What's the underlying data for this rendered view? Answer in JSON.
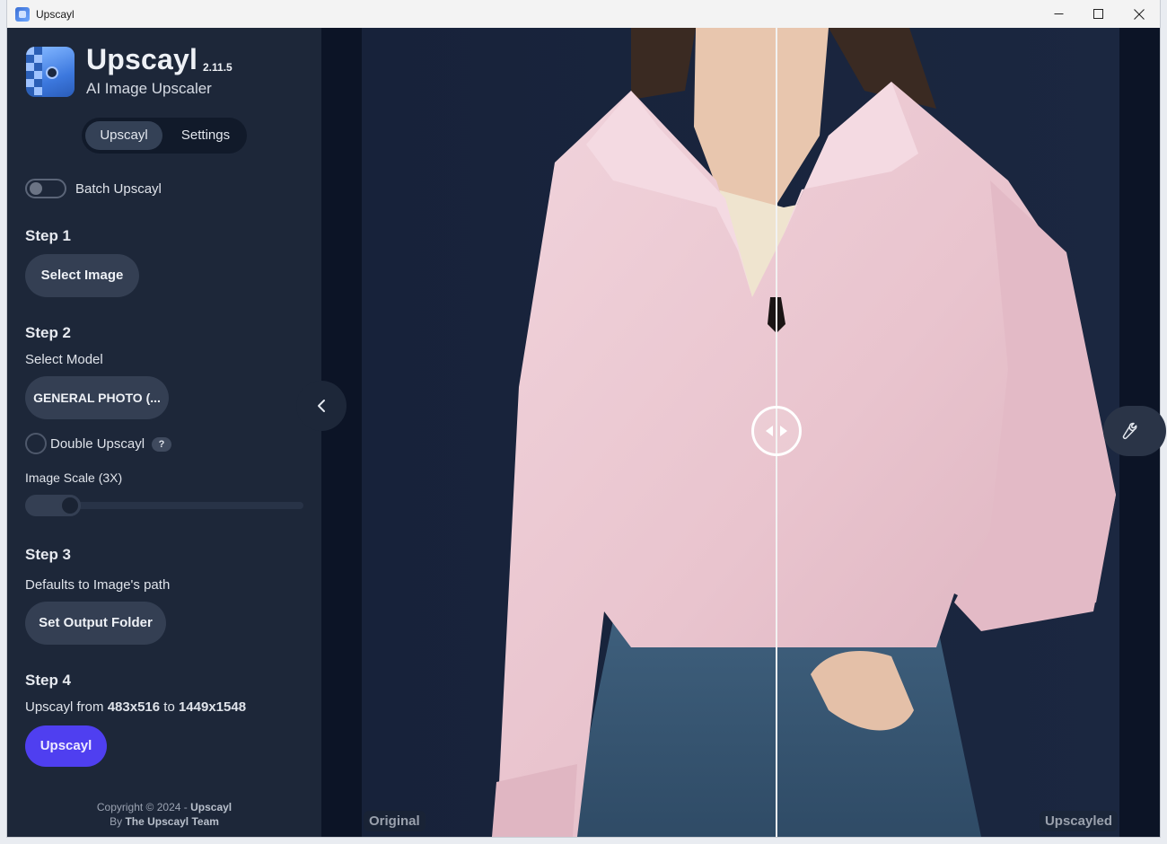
{
  "window": {
    "title": "Upscayl"
  },
  "brand": {
    "name": "Upscayl",
    "version": "2.11.5",
    "subtitle": "AI Image Upscaler"
  },
  "tabs": [
    {
      "label": "Upscayl",
      "active": true
    },
    {
      "label": "Settings",
      "active": false
    }
  ],
  "batch": {
    "label": "Batch Upscayl",
    "enabled": false
  },
  "step1": {
    "title": "Step 1",
    "button": "Select Image"
  },
  "step2": {
    "title": "Step 2",
    "model_label": "Select Model",
    "model_value": "GENERAL PHOTO (...",
    "double_label": "Double Upscayl",
    "help": "?",
    "scale_label": "Image Scale (3X)",
    "scale_value": 3
  },
  "step3": {
    "title": "Step 3",
    "desc": "Defaults to Image's path",
    "button": "Set Output Folder"
  },
  "step4": {
    "title": "Step 4",
    "prefix": "Upscayl from",
    "from": "483x516",
    "mid": "to",
    "to": "1449x1548",
    "button": "Upscayl"
  },
  "footer": {
    "copyright": "Copyright © 2024 -",
    "brand": "Upscayl",
    "by": "By",
    "team": "The Upscayl Team"
  },
  "viewer": {
    "left_label": "Original",
    "right_label": "Upscayled",
    "split_fraction": 0.5
  },
  "colors": {
    "sidebar_bg": "#1d2739",
    "accent": "#4f3ff0",
    "viewer_bg": "#0c1426"
  },
  "icons": {
    "collapse": "chevron-left-icon",
    "tools": "wrench-icon",
    "compare": "arrows-left-right-icon"
  }
}
